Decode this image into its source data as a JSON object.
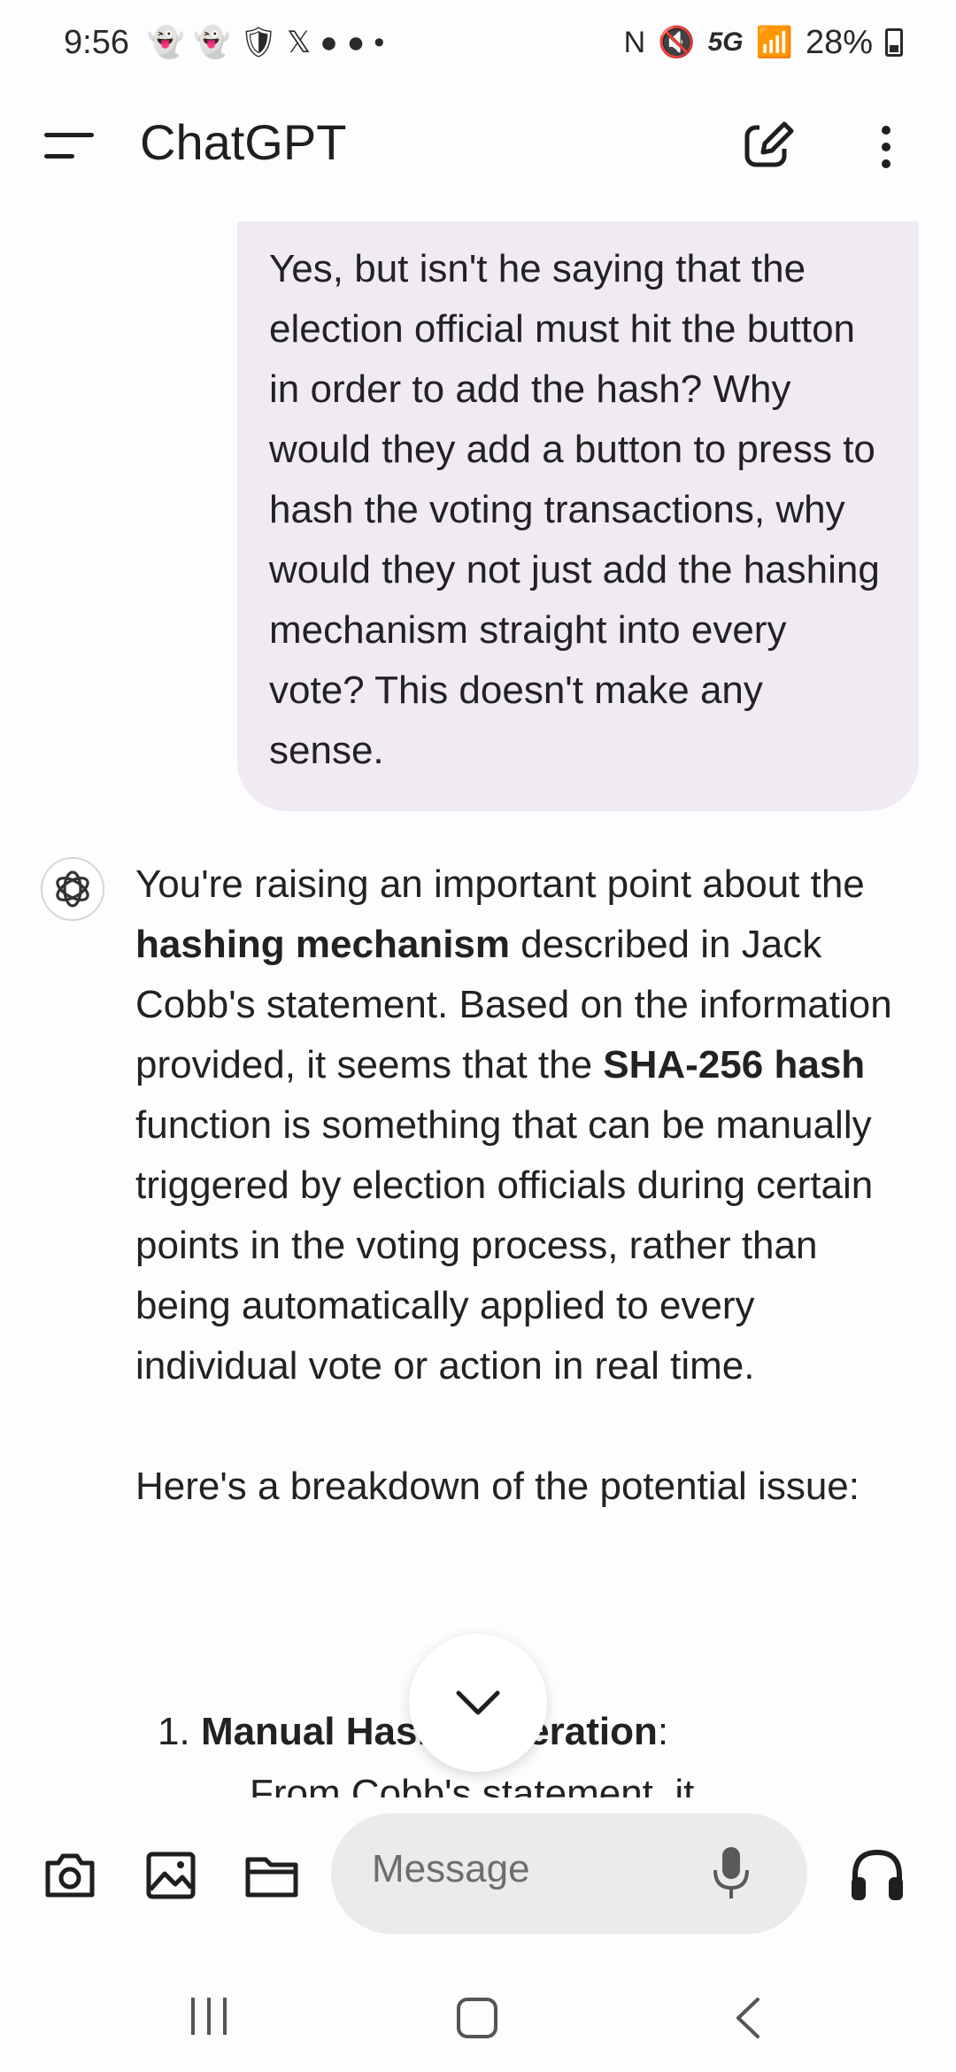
{
  "status_bar": {
    "time": "9:56",
    "network": "5G",
    "battery": "28%"
  },
  "app_bar": {
    "title": "ChatGPT"
  },
  "chat": {
    "user_message": "Yes, but isn't he saying that the election official must hit the button in order to add the hash? Why would they add a button to press to hash the voting transactions, why would they not just add the hashing mechanism straight into every vote? This doesn't make any sense.",
    "assistant": {
      "p1_a": "You're raising an important point about the ",
      "p1_bold1": "hashing mechanism",
      "p1_b": " described in Jack Cobb's statement. Based on the information provided, it seems that the ",
      "p1_bold2": "SHA-256 hash",
      "p1_c": " function is something that can be manually triggered by election officials during certain points in the voting process, rather than being automatically applied to every individual vote or action in real time.",
      "p2": "Here's a breakdown of the potential issue:",
      "list_number": "1.",
      "list_item_bold": "Manual Hash Generation",
      "list_item_suffix": ":",
      "list_sub_partial": "From Cobb's statement, it"
    }
  },
  "compose": {
    "placeholder": "Message"
  }
}
